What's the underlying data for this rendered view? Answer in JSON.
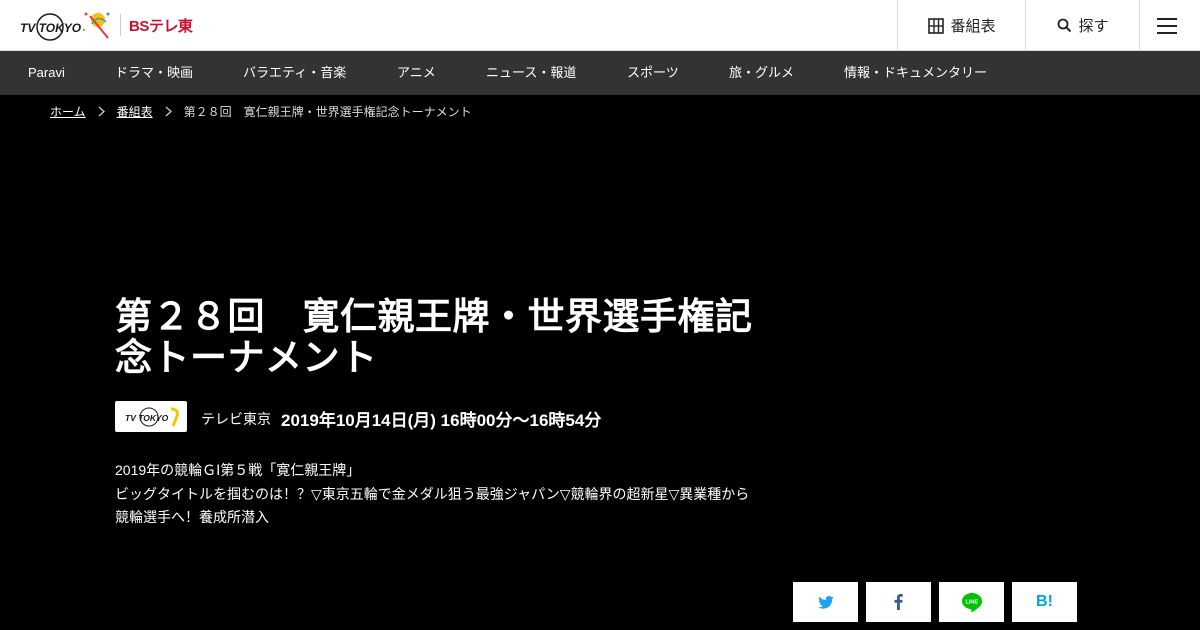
{
  "header": {
    "logo_text": "TV TOKYO",
    "bs_logo": "BSテレ東",
    "schedule_label": "番組表",
    "search_label": "探す"
  },
  "nav": {
    "items": [
      {
        "label": "Paravi"
      },
      {
        "label": "ドラマ・映画"
      },
      {
        "label": "バラエティ・音楽"
      },
      {
        "label": "アニメ"
      },
      {
        "label": "ニュース・報道"
      },
      {
        "label": "スポーツ"
      },
      {
        "label": "旅・グルメ"
      },
      {
        "label": "情報・ドキュメンタリー"
      }
    ]
  },
  "breadcrumb": {
    "home": "ホーム",
    "schedule": "番組表",
    "current": "第２８回　寛仁親王牌・世界選手権記念トーナメント"
  },
  "program": {
    "title": "第２８回　寛仁親王牌・世界選手権記念トーナメント",
    "station_logo_text": "TV TOKYO",
    "station": "テレビ東京",
    "airtime": "2019年10月14日(月) 16時00分～16時54分",
    "description": [
      "2019年の競輪ＧⅠ第５戦「寛仁親王牌」",
      "ビッグタイトルを掴むのは！？▽東京五輪で金メダル狙う最強ジャパン▽競輪界の超新星▽異業種から競輪選手へ！養成所潜入"
    ]
  },
  "share": {
    "hatena_label": "B!"
  },
  "colors": {
    "nav_bg": "#333333",
    "page_bg": "#000000",
    "bs_red": "#c8102e",
    "twitter": "#1da1f2",
    "facebook": "#3b5998",
    "line": "#00c300",
    "hatena": "#00a4de"
  }
}
